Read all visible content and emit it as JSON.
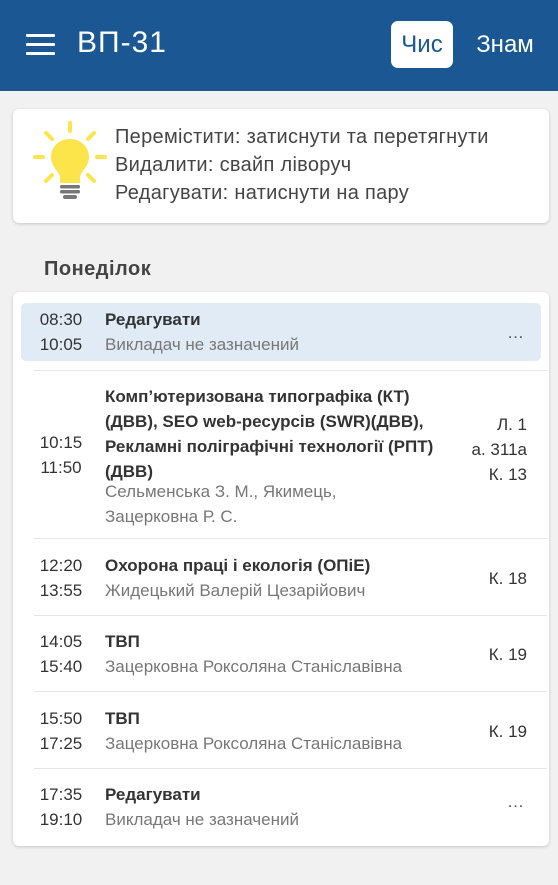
{
  "app": {
    "title": "ВП-31",
    "toggle_numerator": "Чис",
    "toggle_denominator": "Знам"
  },
  "hint": {
    "move": "Перемістити: затиснути та перетягнути",
    "delete": "Видалити: свайп ліворуч",
    "edit": "Редагувати: натиснути на пару"
  },
  "day": {
    "title": "Понеділок",
    "lessons": [
      {
        "start": "08:30",
        "end": "10:05",
        "subject": "Редагувати",
        "teacher": "Викладач не зазначений",
        "more": "…"
      },
      {
        "start": "10:15",
        "end": "11:50",
        "subject_lines": [
          "Комп’ютеризована типографіка (КТ)",
          "(ДВВ), SEO web-ресурсів (SWR)(ДВВ),",
          "Рекламні поліграфічні технології (РПТ)",
          "(ДВВ)"
        ],
        "teacher_lines": [
          "Сельменська З. М., Якимець,",
          "Зацерковна Р. С."
        ],
        "rooms": [
          "Л. 1",
          "а. 311а",
          "К. 13"
        ]
      },
      {
        "start": "12:20",
        "end": "13:55",
        "subject": "Охорона праці і екологія (ОПіЕ)",
        "teacher": "Жидецький Валерій Цезарійович",
        "room": "К. 18"
      },
      {
        "start": "14:05",
        "end": "15:40",
        "subject": "ТВП",
        "teacher": "Зацерковна Роксоляна Станіславівна",
        "room": "К. 19"
      },
      {
        "start": "15:50",
        "end": "17:25",
        "subject": "ТВП",
        "teacher": "Зацерковна Роксоляна Станіславівна",
        "room": "К. 19"
      },
      {
        "start": "17:35",
        "end": "19:10",
        "subject": "Редагувати",
        "teacher": "Викладач не зазначений",
        "more": "…"
      }
    ]
  },
  "colors": {
    "appbar": "#1b5893",
    "highlight": "#e0ebf6",
    "bulb": "#fce54a",
    "background": "#f1f1f1"
  },
  "icons": {
    "menu": "menu-icon",
    "hint": "lightbulb-icon",
    "more": "more-icon"
  }
}
